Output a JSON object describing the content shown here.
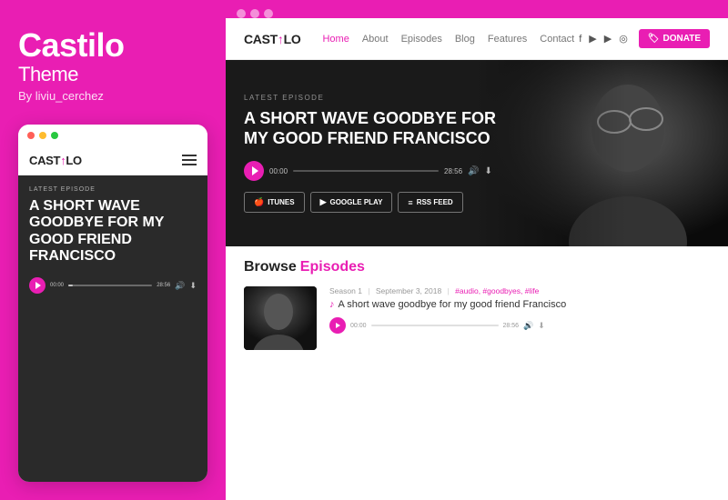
{
  "leftPanel": {
    "brandTitle": "Castilo",
    "brandSubtitle": "Theme",
    "brandAuthor": "By liviu_cerchez"
  },
  "mobileMockup": {
    "logo": "CAST",
    "logoMid": "↑",
    "logoEnd": "LO",
    "latestLabel": "LATEST EPISODE",
    "episodeTitle": "A SHORT WAVE GOODBYE FOR MY GOOD FRIEND FRANCISCO",
    "timeStart": "00:00",
    "timeEnd": "28:56"
  },
  "browser": {
    "dots": [
      "red",
      "yellow",
      "green"
    ]
  },
  "siteNav": {
    "logo": "CAST",
    "logoMid": "↑",
    "logoEnd": "LO",
    "links": [
      {
        "label": "Home",
        "active": true
      },
      {
        "label": "About",
        "active": false
      },
      {
        "label": "Episodes",
        "active": false
      },
      {
        "label": "Blog",
        "active": false
      },
      {
        "label": "Features",
        "active": false
      },
      {
        "label": "Contact",
        "active": false
      }
    ],
    "donateLabel": "DONATE"
  },
  "hero": {
    "latestLabel": "LATEST EPISODE",
    "episodeTitle": "A SHORT WAVE GOODBYE FOR MY GOOD FRIEND FRANCISCO",
    "timeStart": "00:00",
    "timeEnd": "28:56",
    "subscribeButtons": [
      {
        "label": "ITUNES",
        "icon": "🍎"
      },
      {
        "label": "GOOGLE PLAY",
        "icon": "▶"
      },
      {
        "label": "RSS FEED",
        "icon": "≡"
      }
    ]
  },
  "browse": {
    "title": "Browse",
    "episodesLabel": "Episodes",
    "episode": {
      "season": "Season 1",
      "date": "September 3, 2018",
      "separator": "|",
      "tags": "#audio, #goodbyes, #life",
      "name": "A short wave goodbye for my good friend Francisco",
      "timeStart": "00:00",
      "timeEnd": "28:56"
    }
  }
}
